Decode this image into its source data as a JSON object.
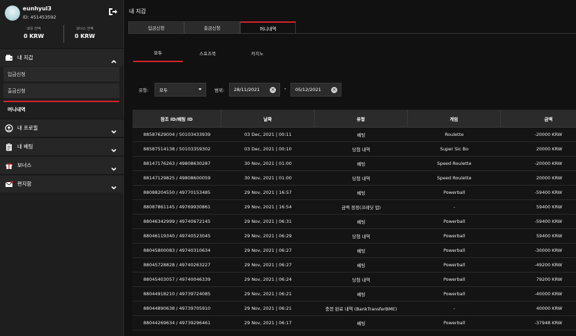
{
  "user": {
    "name": "eunhyul3",
    "id_label": "ID: 451453592"
  },
  "balances": [
    {
      "label": "보유 잔액",
      "value": "0 KRW"
    },
    {
      "label": "보너스 잔액",
      "value": "0 KRW"
    }
  ],
  "sidebar": {
    "wallet": {
      "label": "내 지갑",
      "items": [
        "입금신청",
        "출금신청",
        "머니내역"
      ]
    },
    "profile": "내 프로필",
    "betting": "내 베팅",
    "bonus": "보너스",
    "inbox": "편지함"
  },
  "page_title": "내 지갑",
  "tabs": [
    "입금신청",
    "출금신청",
    "머니내역"
  ],
  "subtabs": [
    "모두",
    "스포츠북",
    "카지노"
  ],
  "filters": {
    "type_label": "유형:",
    "type_value": "모두",
    "range_label": "범위:",
    "date_from": "28/11/2021",
    "date_to": "05/12/2021",
    "dash": "-"
  },
  "table": {
    "headers": [
      "참조 ID/베팅 ID",
      "날짜",
      "유형",
      "게임",
      "금액"
    ],
    "rows": [
      [
        "88587629004 / 50103433939",
        "03 Dec, 2021 | 00:11",
        "베팅",
        "Roulette",
        "-20000 KRW"
      ],
      [
        "88587514138 / 50103359302",
        "03 Dec, 2021 | 00:10",
        "당첨 내역",
        "Super Sic Bo",
        "20000 KRW"
      ],
      [
        "88147176263 / 49808630287",
        "30 Nov, 2021 | 01:00",
        "베팅",
        "Speed Roulette",
        "-20000 KRW"
      ],
      [
        "88147129825 / 49808600059",
        "30 Nov, 2021 | 01:00",
        "당첨 내역",
        "Speed Roulette",
        "20000 KRW"
      ],
      [
        "88088204550 / 49770153485",
        "29 Nov, 2021 | 16:57",
        "베팅",
        "Powerball",
        "-59400 KRW"
      ],
      [
        "88087861145 / 49769930861",
        "29 Nov, 2021 | 16:54",
        "금액 정정(크레딧 업)",
        "-",
        "59400 KRW"
      ],
      [
        "88046342999 / 49740672145",
        "29 Nov, 2021 | 06:31",
        "베팅",
        "Powerball",
        "-59400 KRW"
      ],
      [
        "88046119340 / 49740523045",
        "29 Nov, 2021 | 06:29",
        "당첨 내역",
        "Powerball",
        "59400 KRW"
      ],
      [
        "88045800083 / 49740310634",
        "29 Nov, 2021 | 06:27",
        "베팅",
        "Powerball",
        "-30000 KRW"
      ],
      [
        "88045728828 / 49740263227",
        "29 Nov, 2021 | 06:27",
        "베팅",
        "Powerball",
        "-49200 KRW"
      ],
      [
        "88045403057 / 49740046339",
        "29 Nov, 2021 | 06:24",
        "당첨 내역",
        "Powerball",
        "79200 KRW"
      ],
      [
        "88044918210 / 49739724085",
        "29 Nov, 2021 | 06:21",
        "베팅",
        "Powerball",
        "-40000 KRW"
      ],
      [
        "88044890638 / 49739705910",
        "29 Nov, 2021 | 06:21",
        "충전 완료 내역 (BankTransferBME)",
        "-",
        "40000 KRW"
      ],
      [
        "88044269634 / 49739296461",
        "29 Nov, 2021 | 06:17",
        "베팅",
        "Powerball",
        "-37948 KRW"
      ]
    ]
  },
  "icons": {
    "logout": "logout-icon",
    "wallet": "wallet-icon",
    "profile": "user-icon",
    "betting": "clipboard-icon",
    "bonus": "gift-icon",
    "inbox": "envelope-icon"
  },
  "colors": {
    "accent": "#d9232b",
    "sidebar_bg": "#1e1e1e",
    "main_bg": "#111111"
  }
}
